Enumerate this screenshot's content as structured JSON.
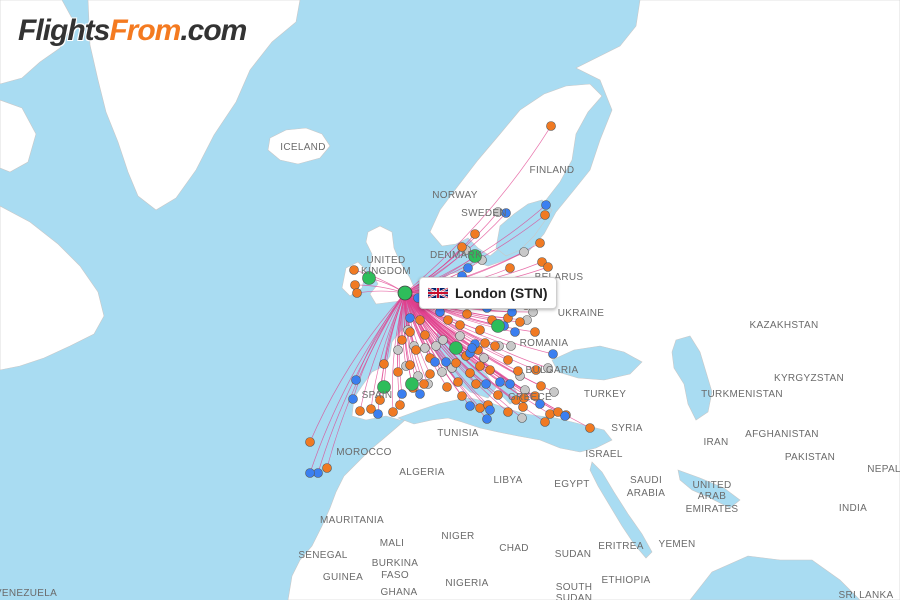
{
  "brand": {
    "part1": "Flights",
    "part2": "From",
    "part3": ".com"
  },
  "airport_label": "London (STN)",
  "country_labels": [
    {
      "name": "ICELAND"
    },
    {
      "name": "NORWAY"
    },
    {
      "name": "SWEDEN"
    },
    {
      "name": "FINLAND"
    },
    {
      "name": "UNITED"
    },
    {
      "name": "KINGDOM"
    },
    {
      "name": "DENMARK"
    },
    {
      "name": "BELARUS"
    },
    {
      "name": "UKRAINE"
    },
    {
      "name": "KAZAKHSTAN"
    },
    {
      "name": "ROMANIA"
    },
    {
      "name": "BULGARIA"
    },
    {
      "name": "KYRGYZSTAN"
    },
    {
      "name": "TURKEY"
    },
    {
      "name": "TURKMENISTAN"
    },
    {
      "name": "SPAIN"
    },
    {
      "name": "GREECE"
    },
    {
      "name": "TUNISIA"
    },
    {
      "name": "SYRIA"
    },
    {
      "name": "IRAN"
    },
    {
      "name": "AFGHANISTAN"
    },
    {
      "name": "ISRAEL"
    },
    {
      "name": "PAKISTAN"
    },
    {
      "name": "MOROCCO"
    },
    {
      "name": "ALGERIA"
    },
    {
      "name": "LIBYA"
    },
    {
      "name": "EGYPT"
    },
    {
      "name": "SAUDI"
    },
    {
      "name": "ARABIA"
    },
    {
      "name": "UNITED"
    },
    {
      "name": "ARAB"
    },
    {
      "name": "EMIRATES"
    },
    {
      "name": "NEPAL"
    },
    {
      "name": "INDIA"
    },
    {
      "name": "MAURITANIA"
    },
    {
      "name": "MALI"
    },
    {
      "name": "NIGER"
    },
    {
      "name": "CHAD"
    },
    {
      "name": "SUDAN"
    },
    {
      "name": "ERITREA"
    },
    {
      "name": "YEMEN"
    },
    {
      "name": "SENEGAL"
    },
    {
      "name": "BURKINA"
    },
    {
      "name": "FASO"
    },
    {
      "name": "NIGERIA"
    },
    {
      "name": "GUINEA"
    },
    {
      "name": "GHANA"
    },
    {
      "name": "SOUTH"
    },
    {
      "name": "SUDAN"
    },
    {
      "name": "ETHIOPIA"
    },
    {
      "name": "SRI LANKA"
    },
    {
      "name": "VENEZUELA"
    }
  ],
  "colors": {
    "water": "#a9dcf2",
    "land": "#ffffff",
    "border": "#c8c8c8",
    "route": "#e0408e",
    "hub": "#2ebd5b",
    "orange": "#f07a23",
    "blue": "#3b7ff0",
    "gray": "#c8c8c8"
  },
  "flag_icon": "uk-flag-icon"
}
